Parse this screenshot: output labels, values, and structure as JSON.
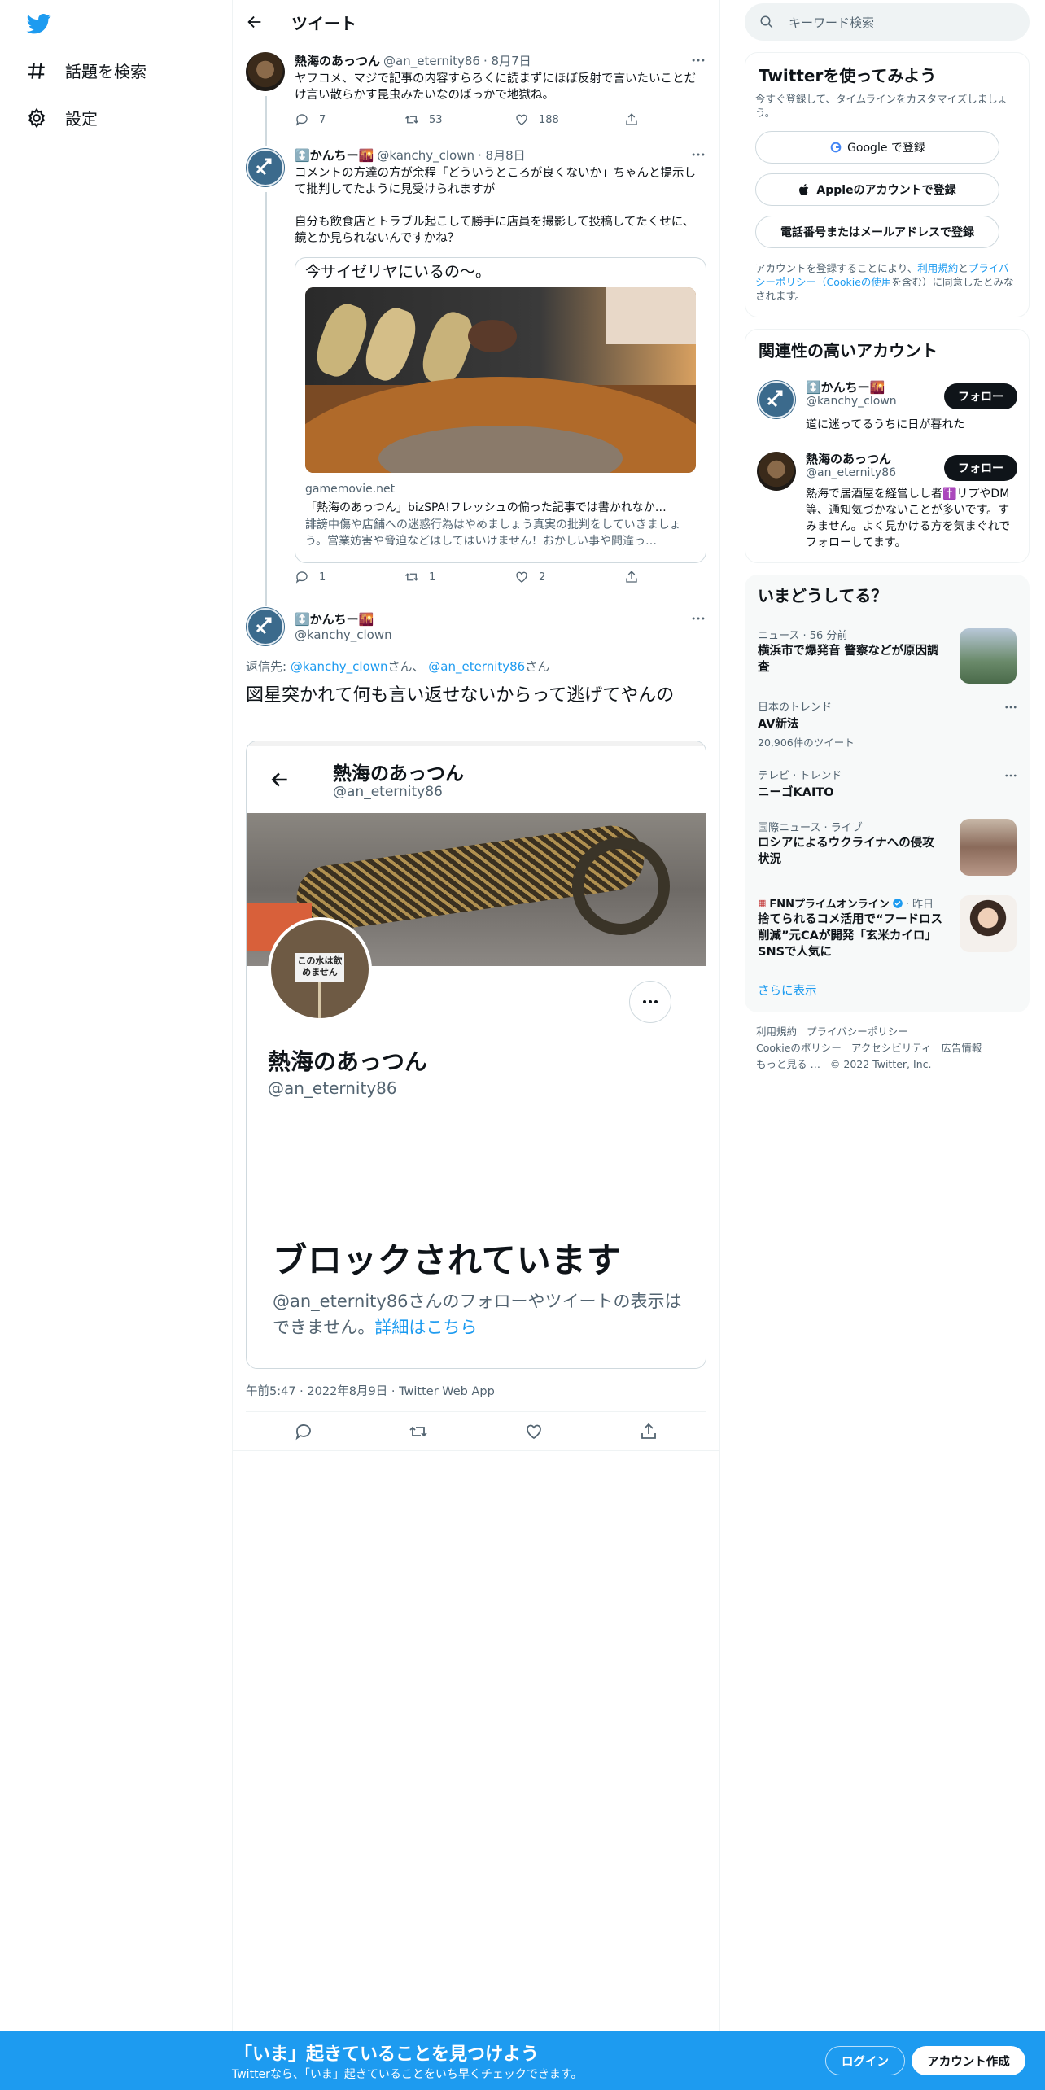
{
  "nav": {
    "explore": "話題を検索",
    "settings": "設定"
  },
  "header": {
    "title": "ツイート"
  },
  "tweet1": {
    "name": "熱海のあっつん",
    "handle": "@an_eternity86",
    "date": "· 8月7日",
    "text": "ヤフコメ、マジで記事の内容すらろくに読まずにほぼ反射で言いたいことだけ言い散らかす昆虫みたいなのばっかで地獄ね。",
    "replies": "7",
    "retweets": "53",
    "likes": "188"
  },
  "tweet2": {
    "name": "↕️かんちー🌇",
    "handle": "@kanchy_clown",
    "date": "· 8月8日",
    "text": "コメントの方達の方が余程「どういうところが良くないか」ちゃんと提示して批判してたように見受けられますが\n\n自分も飲食店とトラブル起こして勝手に店員を撮影して投稿してたくせに、鏡とか見られないんですかね？",
    "card_caption": "今サイゼリヤにいるの〜。",
    "card_domain": "gamemovie.net",
    "card_title": "「熱海のあっつん」bizSPA!フレッシュの偏った記事では書かれなか…",
    "card_desc": "誹謗中傷や店舗への迷惑行為はやめましょう真実の批判をしていきましょう。営業妨害や脅迫などはしてはいけません！おかしい事や間違っ…",
    "replies": "1",
    "retweets": "1",
    "likes": "2"
  },
  "tweet3": {
    "name": "↕️かんちー🌇",
    "handle": "@kanchy_clown",
    "reply_to_label": "返信先:",
    "reply_user1": "@kanchy_clown",
    "reply_san1": "さん、",
    "reply_user2": "@an_eternity86",
    "reply_san2": "さん",
    "text": "図星突かれて何も言い返せないからって逃げてやんの",
    "meta": "午前5:47 · 2022年8月9日 · Twitter Web App"
  },
  "screenshot": {
    "name": "熱海のあっつん",
    "handle": "@an_eternity86",
    "profile_name": "熱海のあっつん",
    "profile_handle": "@an_eternity86",
    "sign_text": "この水は飲めません",
    "blocked_title": "ブロックされています",
    "blocked_text": "@an_eternity86さんのフォローやツイートの表示はできません。",
    "blocked_link": "詳細はこちら"
  },
  "search": {
    "placeholder": "キーワード検索"
  },
  "signup": {
    "title": "Twitterを使ってみよう",
    "subtitle": "今すぐ登録して、タイムラインをカスタマイズしましょう。",
    "google": "Google で登録",
    "apple": "Appleのアカウントで登録",
    "phone": "電話番号またはメールアドレスで登録",
    "terms_pre": "アカウントを登録することにより、",
    "terms_link1": "利用規約",
    "terms_and": "と",
    "terms_link2": "プライバシーポリシー（Cookieの使用",
    "terms_post": "を含む）に同意したとみなされます。"
  },
  "related": {
    "title": "関連性の高いアカウント",
    "accounts": [
      {
        "name": "↕️かんちー🌇",
        "handle": "@kanchy_clown",
        "bio": "道に迷ってるうちに日が暮れた",
        "follow": "フォロー"
      },
      {
        "name": "熱海のあっつん",
        "handle": "@an_eternity86",
        "bio": "熱海で居酒屋を経営しし者✝️リプやDM等、通知気づかないことが多いです。すみません。よく見かける方を気まぐれでフォローしてます。",
        "follow": "フォロー"
      }
    ]
  },
  "trends": {
    "title": "いまどうしてる？",
    "items": [
      {
        "meta": "ニュース · 56 分前",
        "title": "横浜市で爆発音 警察などが原因調査"
      },
      {
        "meta": "日本のトレンド",
        "title": "AV新法",
        "count": "20,906件のツイート"
      },
      {
        "meta": "テレビ · トレンド",
        "title": "ニーゴKAITO"
      },
      {
        "meta": "国際ニュース · ライブ",
        "title": "ロシアによるウクライナへの侵攻状況"
      },
      {
        "meta_name": "FNNプライムオンライン",
        "meta_time": "· 昨日",
        "title": "捨てられるコメ活用で“フードロス削減”元CAが開発「玄米カイロ」SNSで人気に"
      }
    ],
    "show_more": "さらに表示"
  },
  "footer": {
    "terms": "利用規約",
    "privacy": "プライバシーポリシー",
    "cookie": "Cookieのポリシー",
    "accessibility": "アクセシビリティ",
    "ads": "広告情報",
    "more": "もっと見る …",
    "copyright": "© 2022 Twitter, Inc."
  },
  "banner": {
    "title": "「いま」起きていることを見つけよう",
    "subtitle": "Twitterなら、「いま」起きていることをいち早くチェックできます。",
    "login": "ログイン",
    "signup": "アカウント作成"
  },
  "colors": {
    "accent": "#1d9bf0",
    "text": "#0f1419",
    "muted": "#536471"
  }
}
